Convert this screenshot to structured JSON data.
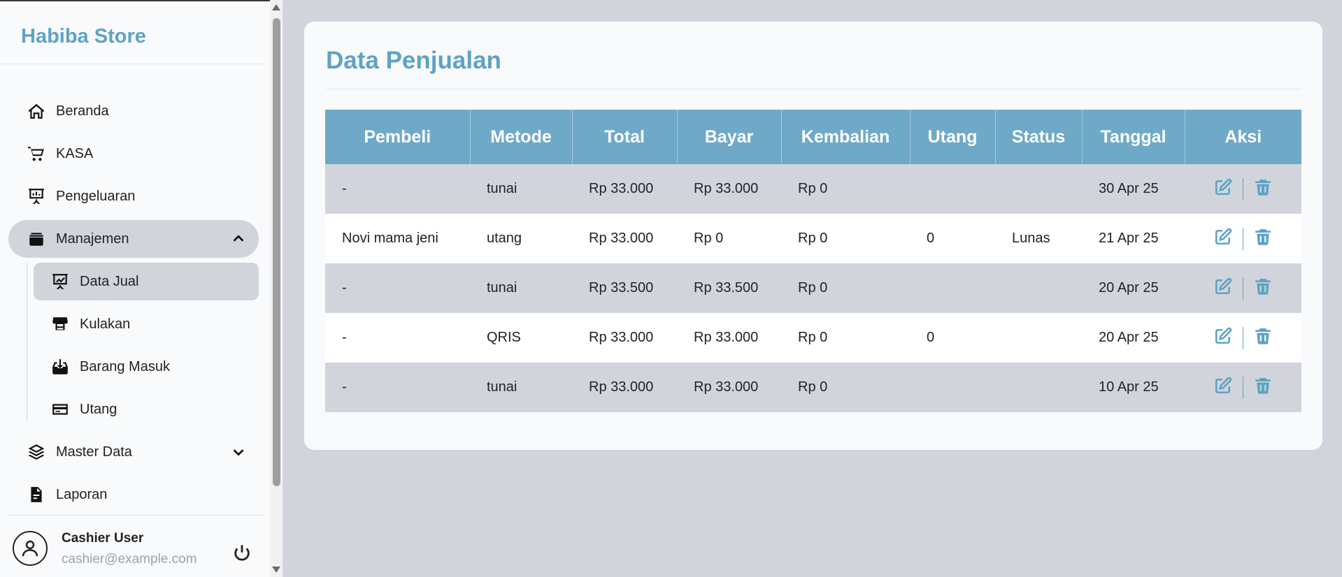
{
  "brand": "Habiba Store",
  "sidebar": {
    "items": [
      {
        "label": "Beranda",
        "icon": "home-icon"
      },
      {
        "label": "KASA",
        "icon": "cart-icon"
      },
      {
        "label": "Pengeluaran",
        "icon": "expense-icon"
      },
      {
        "label": "Manajemen",
        "icon": "box-icon",
        "expanded": true
      },
      {
        "label": "Master Data",
        "icon": "layers-icon",
        "expanded": false
      },
      {
        "label": "Laporan",
        "icon": "file-icon"
      }
    ],
    "submenu": [
      {
        "label": "Data Jual",
        "icon": "chart-board-icon",
        "active": true
      },
      {
        "label": "Kulakan",
        "icon": "store-icon"
      },
      {
        "label": "Barang Masuk",
        "icon": "inbox-download-icon"
      },
      {
        "label": "Utang",
        "icon": "credit-card-icon"
      }
    ]
  },
  "user": {
    "name": "Cashier User",
    "email": "cashier@example.com"
  },
  "page": {
    "title": "Data Penjualan"
  },
  "table": {
    "headers": [
      "Pembeli",
      "Metode",
      "Total",
      "Bayar",
      "Kembalian",
      "Utang",
      "Status",
      "Tanggal",
      "Aksi"
    ],
    "rows": [
      [
        "-",
        "tunai",
        "Rp 33.000",
        "Rp 33.000",
        "Rp 0",
        "",
        "",
        "30 Apr 25"
      ],
      [
        "Novi mama jeni",
        "utang",
        "Rp 33.000",
        "Rp 0",
        "Rp 0",
        "0",
        "Lunas",
        "21 Apr 25"
      ],
      [
        "-",
        "tunai",
        "Rp 33.500",
        "Rp 33.500",
        "Rp 0",
        "",
        "",
        "20 Apr 25"
      ],
      [
        "-",
        "QRIS",
        "Rp 33.000",
        "Rp 33.000",
        "Rp 0",
        "0",
        "",
        "20 Apr 25"
      ],
      [
        "-",
        "tunai",
        "Rp 33.000",
        "Rp 33.000",
        "Rp 0",
        "",
        "",
        "10 Apr 25"
      ]
    ]
  },
  "colors": {
    "accent": "#5ea3c4",
    "header_bg": "#6fa9c8",
    "page_bg": "#d1d5db"
  }
}
